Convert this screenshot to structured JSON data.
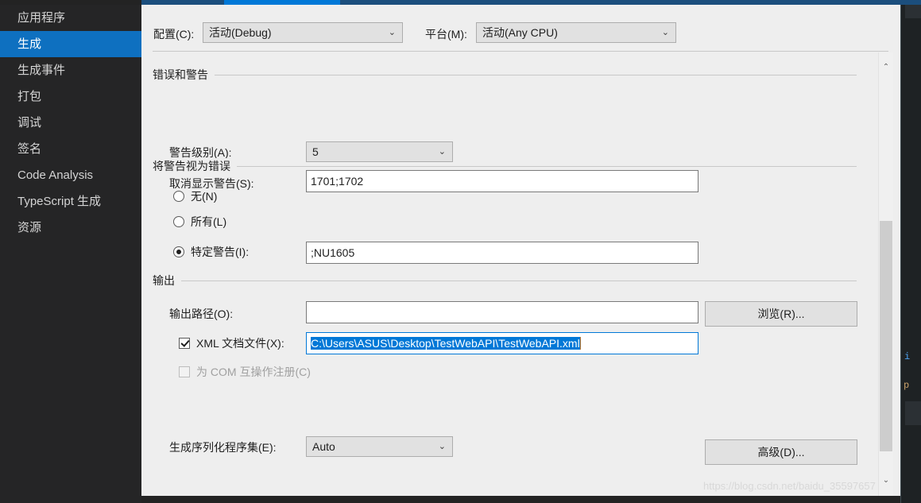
{
  "app": {
    "theme_accent": "#0078d7",
    "nav_selected_bg": "#0e70c0",
    "panel_bg": "#eeeeee",
    "nav_bg": "#252526"
  },
  "sidebar": {
    "items": [
      {
        "label": "应用程序",
        "selected": false
      },
      {
        "label": "生成",
        "selected": true
      },
      {
        "label": "生成事件",
        "selected": false
      },
      {
        "label": "打包",
        "selected": false
      },
      {
        "label": "调试",
        "selected": false
      },
      {
        "label": "签名",
        "selected": false
      },
      {
        "label": "Code Analysis",
        "selected": false
      },
      {
        "label": "TypeScript 生成",
        "selected": false
      },
      {
        "label": "资源",
        "selected": false
      }
    ]
  },
  "header": {
    "configuration_label": "配置(C):",
    "configuration_value": "活动(Debug)",
    "platform_label": "平台(M):",
    "platform_value": "活动(Any CPU)"
  },
  "errors_warnings": {
    "group_title": "错误和警告",
    "warning_level_label": "警告级别(A):",
    "warning_level_value": "5",
    "suppress_warnings_label": "取消显示警告(S):",
    "suppress_warnings_value": "1701;1702"
  },
  "treat_warnings": {
    "group_title": "将警告视为错误",
    "options": [
      {
        "label": "无(N)",
        "checked": false
      },
      {
        "label": "所有(L)",
        "checked": false
      },
      {
        "label": "特定警告(I):",
        "checked": true
      }
    ],
    "specific_warnings_value": ";NU1605"
  },
  "output": {
    "group_title": "输出",
    "output_path_label": "输出路径(O):",
    "output_path_value": "",
    "browse_button": "浏览(R)...",
    "xml_doc_label": "XML 文档文件(X):",
    "xml_doc_checked": true,
    "xml_doc_value": "C:\\Users\\ASUS\\Desktop\\TestWebAPI\\TestWebAPI.xml",
    "com_interop_label": "为 COM 互操作注册(C)",
    "com_interop_checked": false,
    "com_interop_disabled": true,
    "serialization_label": "生成序列化程序集(E):",
    "serialization_value": "Auto",
    "advanced_button": "高级(D)..."
  },
  "icons": {
    "chevron_down": "⌄",
    "scroll_up": "⌃",
    "scroll_down": "⌄"
  },
  "watermark": {
    "text": "https://blog.csdn.net/baidu_35597657"
  },
  "editor_peek": {
    "line_a": "i",
    "line_b": "p"
  }
}
